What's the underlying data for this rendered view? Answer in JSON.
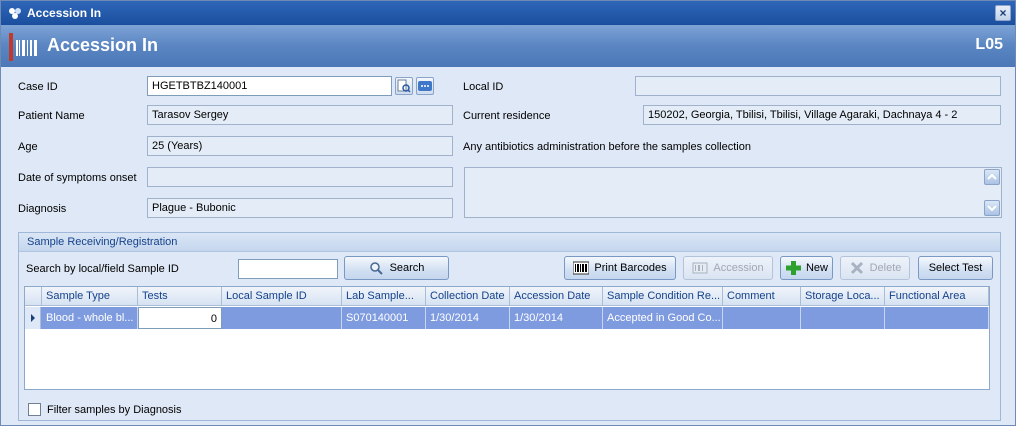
{
  "window": {
    "title": "Accession In",
    "close_glyph": "×"
  },
  "header": {
    "title": "Accession In",
    "code": "L05",
    "icon": "barcode-icon"
  },
  "form": {
    "case_id": {
      "label": "Case ID",
      "value": "HGETBTBZ140001"
    },
    "patient_name": {
      "label": "Patient Name",
      "value": "Tarasov Sergey"
    },
    "age": {
      "label": "Age",
      "value": "25 (Years)"
    },
    "symptoms_onset": {
      "label": "Date of symptoms onset",
      "value": ""
    },
    "diagnosis": {
      "label": "Diagnosis",
      "value": "Plague - Bubonic"
    },
    "local_id": {
      "label": "Local ID",
      "value": ""
    },
    "current_residence": {
      "label": "Current residence",
      "value": "150202, Georgia, Tbilisi, Tbilisi, Village Agaraki, Dachnaya 4 - 2"
    },
    "antibiotics": {
      "label": "Any antibiotics administration before the samples collection",
      "value": ""
    }
  },
  "sample_section": {
    "title": "Sample Receiving/Registration",
    "search_label": "Search by local/field Sample ID",
    "search_value": "",
    "buttons": {
      "search": "Search",
      "print_barcodes": "Print Barcodes",
      "accession": "Accession",
      "new": "New",
      "delete": "Delete",
      "select_test": "Select Test"
    },
    "grid": {
      "columns": [
        "Sample Type",
        "Tests",
        "Local Sample ID",
        "Lab Sample...",
        "Collection Date",
        "Accession Date",
        "Sample Condition Re...",
        "Comment",
        "Storage Loca...",
        "Functional Area"
      ],
      "rows": [
        [
          "Blood - whole bl...",
          "0",
          "",
          "S070140001",
          "1/30/2014",
          "1/30/2014",
          "Accepted in Good Co...",
          "",
          "",
          ""
        ]
      ]
    },
    "filter_label": "Filter samples by Diagnosis",
    "filter_checked": false
  },
  "colors": {
    "title_bar": "#1b4f9e",
    "header": "#5a85c2",
    "selected_row": "#7f9be0",
    "new_icon": "#2da02d"
  }
}
